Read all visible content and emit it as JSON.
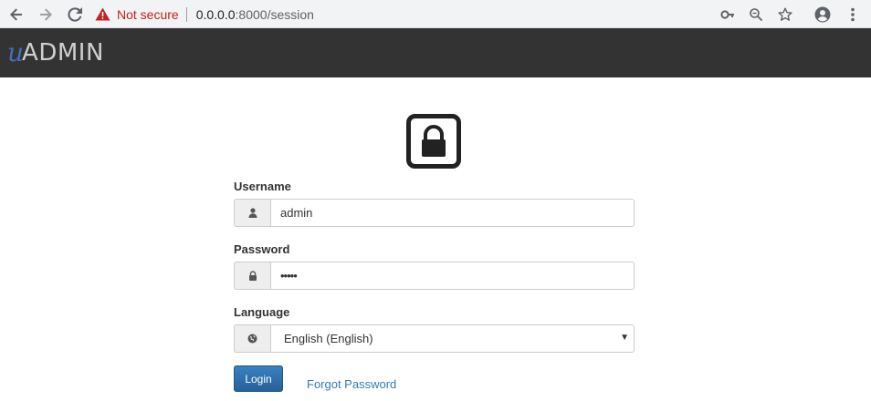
{
  "browser": {
    "security_label": "Not secure",
    "url_host": "0.0.0.0",
    "url_rest": ":8000/session",
    "icons": [
      "back-icon",
      "forward-icon",
      "reload-icon",
      "warning-icon",
      "key-icon",
      "zoom-icon",
      "star-icon",
      "account-icon",
      "menu-icon"
    ]
  },
  "app": {
    "logo_u": "u",
    "logo_admin": "ADMIN",
    "navbar_color": "#333333"
  },
  "login": {
    "lock_icon": "lock-icon",
    "username_label": "Username",
    "username_value": "admin",
    "password_label": "Password",
    "password_value": "•••••",
    "language_label": "Language",
    "language_value": "English (English)",
    "login_button": "Login",
    "forgot_link": "Forgot Password",
    "accent_color": "#2e6da4",
    "link_color": "#337ab7"
  }
}
